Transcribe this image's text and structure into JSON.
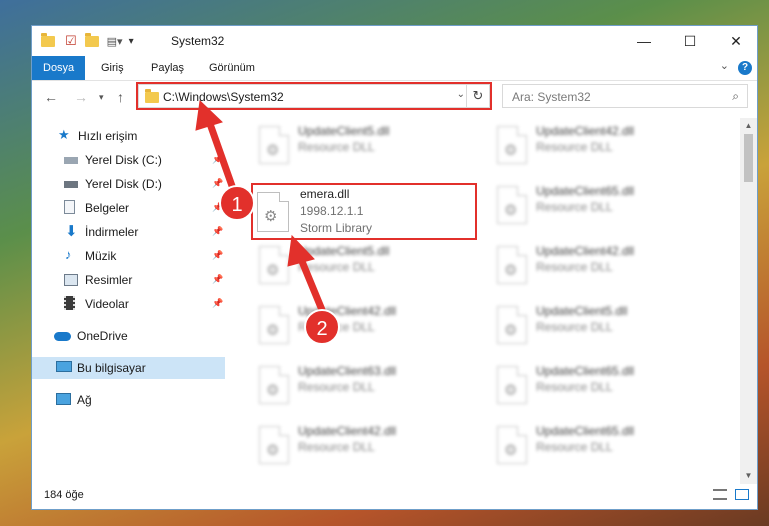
{
  "window": {
    "title": "System32",
    "controls": {
      "minimize": "—",
      "maximize": "☐",
      "close": "✕"
    }
  },
  "ribbon": {
    "tabs": [
      {
        "label": "Dosya",
        "active": true
      },
      {
        "label": "Giriş",
        "active": false
      },
      {
        "label": "Paylaş",
        "active": false
      },
      {
        "label": "Görünüm",
        "active": false
      }
    ],
    "help": "?"
  },
  "address": {
    "path": "C:\\Windows\\System32",
    "search_placeholder": "Ara: System32"
  },
  "sidebar": {
    "items": [
      {
        "label": "Hızlı erişim",
        "icon": "star-icon",
        "pinned": false
      },
      {
        "label": "Yerel Disk (C:)",
        "icon": "drive-icon",
        "pinned": true
      },
      {
        "label": "Yerel Disk (D:)",
        "icon": "drive-icon",
        "pinned": true
      },
      {
        "label": "Belgeler",
        "icon": "document-icon",
        "pinned": true
      },
      {
        "label": "İndirmeler",
        "icon": "download-icon",
        "pinned": true
      },
      {
        "label": "Müzik",
        "icon": "music-icon",
        "pinned": true
      },
      {
        "label": "Resimler",
        "icon": "picture-icon",
        "pinned": true
      },
      {
        "label": "Videolar",
        "icon": "video-icon",
        "pinned": true
      },
      {
        "label": "OneDrive",
        "icon": "cloud-icon",
        "pinned": false
      },
      {
        "label": "Bu bilgisayar",
        "icon": "computer-icon",
        "pinned": false,
        "selected": true
      },
      {
        "label": "Ağ",
        "icon": "network-icon",
        "pinned": false
      }
    ]
  },
  "files": {
    "left": [
      {
        "name": "UpdateClient5.dll",
        "sub": "Resource DLL"
      },
      {
        "name": "UpdateClient5.dll",
        "sub": "Resource DLL"
      },
      {
        "name": "UpdateClient42.dll",
        "sub": "Resource DLL"
      },
      {
        "name": "UpdateClient63.dll",
        "sub": "Resource DLL"
      },
      {
        "name": "UpdateClient42.dll",
        "sub": "Resource DLL"
      }
    ],
    "right": [
      {
        "name": "UpdateClient42.dll",
        "sub": "Resource DLL"
      },
      {
        "name": "UpdateClient65.dll",
        "sub": "Resource DLL"
      },
      {
        "name": "UpdateClient42.dll",
        "sub": "Resource DLL"
      },
      {
        "name": "UpdateClient5.dll",
        "sub": "Resource DLL"
      },
      {
        "name": "UpdateClient65.dll",
        "sub": "Resource DLL"
      },
      {
        "name": "UpdateClient65.dll",
        "sub": "Resource DLL"
      }
    ],
    "highlighted": {
      "name": "emera.dll",
      "version": "1998.12.1.1",
      "company": "Storm Library"
    }
  },
  "status": {
    "count": "184 öğe"
  },
  "callouts": [
    "1",
    "2"
  ],
  "colors": {
    "accent": "#1979ca",
    "highlight": "#e2302b",
    "selected": "#cce4f7"
  }
}
